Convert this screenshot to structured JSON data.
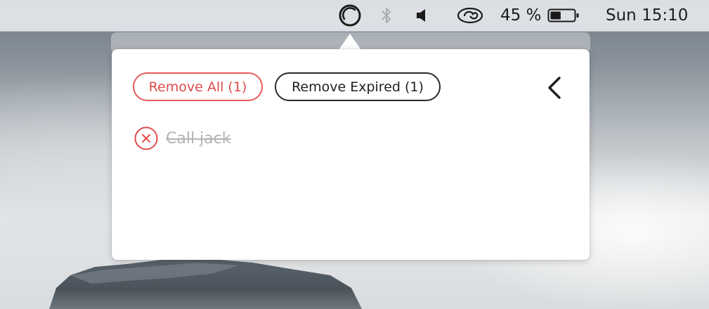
{
  "menubar": {
    "items": [
      {
        "icon": "app-ring-icon"
      },
      {
        "icon": "bluetooth-icon"
      },
      {
        "icon": "volume-icon"
      },
      {
        "icon": "creative-cloud-icon"
      }
    ],
    "battery_percent_text": "45 %",
    "battery_level": 0.45,
    "clock": "Sun 15:10"
  },
  "popover": {
    "remove_all_label": "Remove All (1)",
    "remove_expired_label": "Remove Expired (1)",
    "back_icon": "chevron-left-icon",
    "tasks": [
      {
        "label": "Call jack",
        "status": "expired",
        "remove_icon": "remove-circle-icon"
      }
    ]
  },
  "colors": {
    "accent_red": "#e04b4b",
    "dark_text": "#1f1f1f",
    "muted_text": "#b3b3b3",
    "menubar_bg": "#e2e6ea"
  }
}
